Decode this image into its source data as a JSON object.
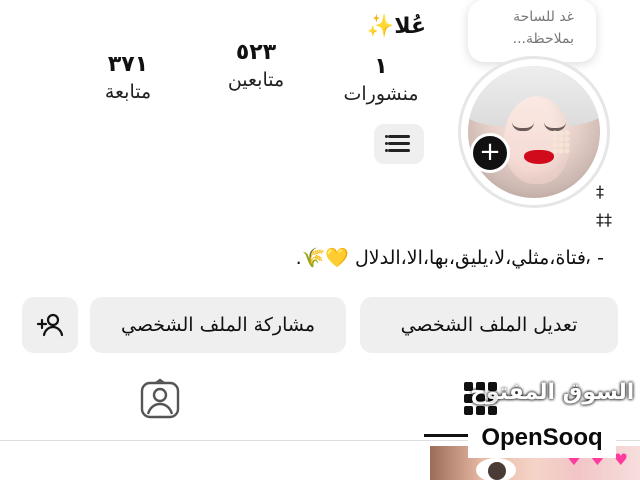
{
  "note": {
    "text": "غد للساحة بملاحظة..."
  },
  "profile": {
    "username": "عُلا",
    "username_emoji": "✨",
    "stats": {
      "posts": {
        "count": "١",
        "label": "منشورات"
      },
      "followers": {
        "count": "٥٢٣",
        "label": "متابعين"
      },
      "following": {
        "count": "٣٧١",
        "label": "متابعة"
      }
    },
    "bio": {
      "line1": "‡",
      "line2": "‡‡",
      "text": "- ⸴فتاة،مثلي،لا،يليق،بها،الا،الدلال 💛🌾."
    }
  },
  "actions": {
    "edit_profile": "تعديل الملف الشخصي",
    "share_profile": "مشاركة الملف الشخصي"
  },
  "icons": {
    "add_story": "plus-icon",
    "menu": "list-icon",
    "add_user": "add-user-icon",
    "tagged": "tagged-person-icon",
    "grid": "grid-icon"
  },
  "watermark": {
    "arabic": "السوق المفتوح",
    "latin": "OpenSooq"
  },
  "colors": {
    "button_bg": "#efefef",
    "text": "#111111",
    "note_text": "#777777",
    "lipstick": "#d10b1b",
    "heart": "#ff3b9d"
  }
}
